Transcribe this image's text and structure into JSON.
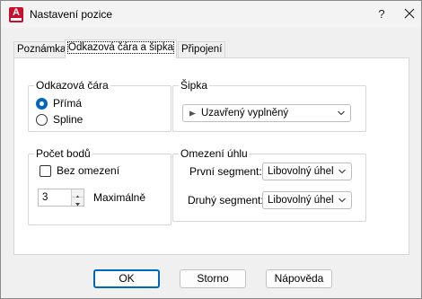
{
  "window": {
    "title": "Nastavení pozice",
    "help_glyph": "?",
    "app_icon_letter": "A",
    "app_icon_color": "#c8102e"
  },
  "tabs": [
    {
      "label": "Poznámka",
      "active": false
    },
    {
      "label": "Odkazová čára a šipka",
      "active": true
    },
    {
      "label": "Připojení",
      "active": false
    }
  ],
  "leader": {
    "legend": "Odkazová čára",
    "options": [
      {
        "label": "Přímá",
        "selected": true
      },
      {
        "label": "Spline",
        "selected": false
      }
    ]
  },
  "arrow": {
    "legend": "Šipka",
    "selected": "Uzavřený vyplněný",
    "icon": "closed-filled-arrow-icon"
  },
  "points": {
    "legend": "Počet bodů",
    "no_limit_label": "Bez omezení",
    "no_limit_checked": false,
    "value": "3",
    "max_label": "Maximálně"
  },
  "angle": {
    "legend": "Omezení úhlu",
    "first_label": "První segment:",
    "first_value": "Libovolný úhel",
    "second_label": "Druhý segment:",
    "second_value": "Libovolný úhel"
  },
  "buttons": {
    "ok": "OK",
    "cancel": "Storno",
    "help": "Nápověda"
  },
  "colors": {
    "accent": "#0067c0"
  }
}
